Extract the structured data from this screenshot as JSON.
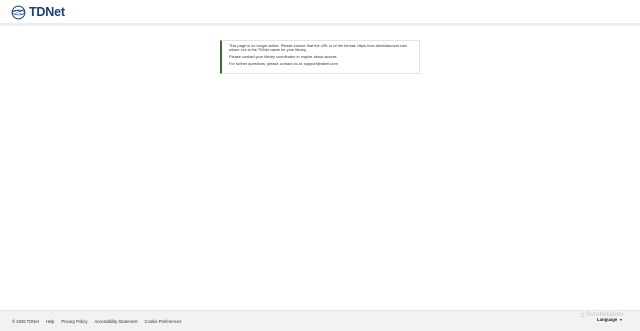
{
  "header": {
    "brand": "TDNet"
  },
  "notice": {
    "line1": "This page is no longer active. Please ensure that the URL is of the format: https://xxx.tdnetdiscover.com where xxx is the TDNet name for your library.",
    "line2": "Please contact your library coordinator to inquire about access.",
    "line3": "For further questions, please contact us at: support@tdnet.com",
    "accent_color": "#3c6b35"
  },
  "footer": {
    "copyright": "© 2026 TDNet",
    "links": [
      "Help",
      "Privacy Policy",
      "Accessibility Statement",
      "Cookie Preferences"
    ],
    "language_label": "Language"
  },
  "watermark": {
    "text": "Scrollstation"
  }
}
